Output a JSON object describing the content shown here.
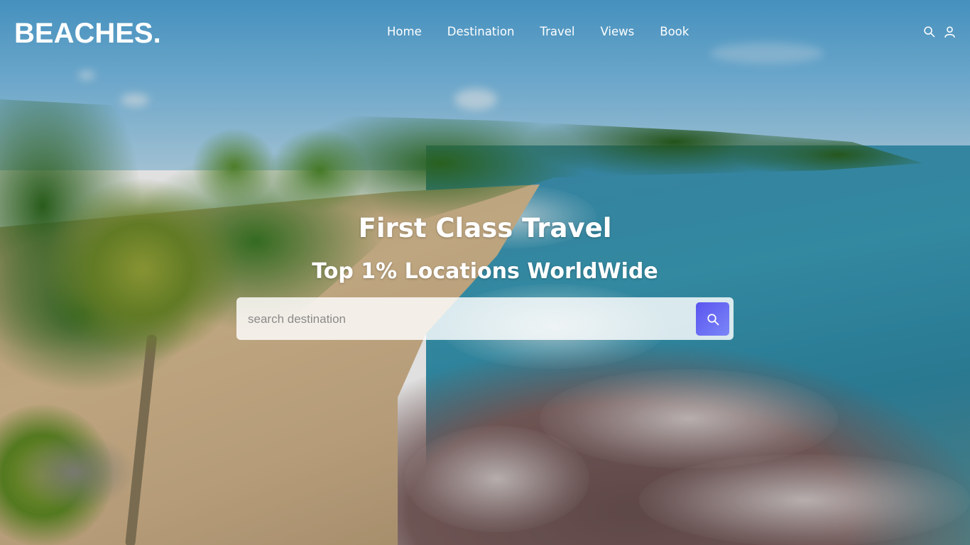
{
  "header": {
    "logo": "BEACHES.",
    "nav": [
      {
        "label": "Home"
      },
      {
        "label": "Destination"
      },
      {
        "label": "Travel"
      },
      {
        "label": "Views"
      },
      {
        "label": "Book"
      }
    ],
    "icons": [
      "search-icon",
      "user-icon"
    ]
  },
  "hero": {
    "title": "First Class Travel",
    "subtitle": "Top 1% Locations WorldWide",
    "search": {
      "placeholder": "search destination",
      "value": "",
      "button_icon": "search-icon"
    }
  },
  "colors": {
    "text": "#ffffff",
    "button_gradient_start": "#5a55f0",
    "button_gradient_end": "#7b86f7",
    "search_bg": "rgba(255,255,255,0.82)"
  }
}
